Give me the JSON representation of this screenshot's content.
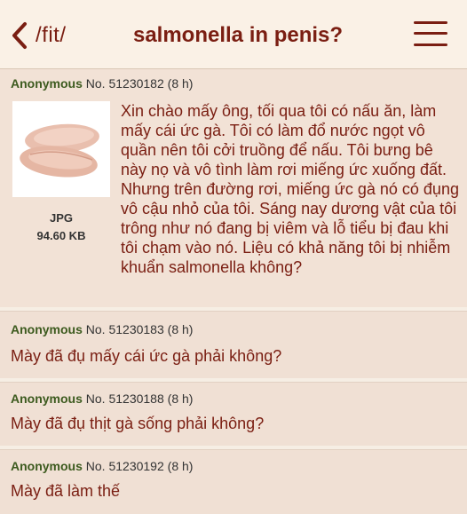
{
  "header": {
    "back_icon": "chevron-left-icon",
    "board": "/fit/",
    "title": "salmonella in penis?",
    "menu_icon": "hamburger-menu-icon"
  },
  "posts": [
    {
      "name": "Anonymous",
      "no_label": "No.",
      "number": "51230182",
      "replies": "(8 h)",
      "file_type": "JPG",
      "file_size": "94.60 KB",
      "thumbnail": "raw chicken breast image",
      "text": "Xin chào mấy ông, tối qua tôi có nấu ăn, làm mấy cái ức gà. Tôi có làm đổ nước ngọt vô quần nên tôi cởi truồng để nấu. Tôi bưng bê này nọ và vô tình làm rơi miếng ức xuống đất. Nhưng trên đường rơi, miếng ức gà nó có đụng vô cậu nhỏ của tôi. Sáng nay dương vật của tôi trông như nó đang bị viêm và lỗ tiểu bị đau khi tôi chạm vào nó. Liệu có khả năng tôi bị nhiễm khuẩn salmonella không?"
    },
    {
      "name": "Anonymous",
      "no_label": "No.",
      "number": "51230183",
      "replies": "(8 h)",
      "text": "Mày đã đụ mấy cái ức gà phải không?"
    },
    {
      "name": "Anonymous",
      "no_label": "No.",
      "number": "51230188",
      "replies": "(8 h)",
      "text": "Mày đã đụ thịt gà sống phải không?"
    },
    {
      "name": "Anonymous",
      "no_label": "No.",
      "number": "51230192",
      "replies": "(8 h)",
      "text": "Mày đã làm thế"
    }
  ],
  "colors": {
    "accent": "#7a1e12",
    "name": "#4a3a8c",
    "background": "#f6eee4"
  }
}
